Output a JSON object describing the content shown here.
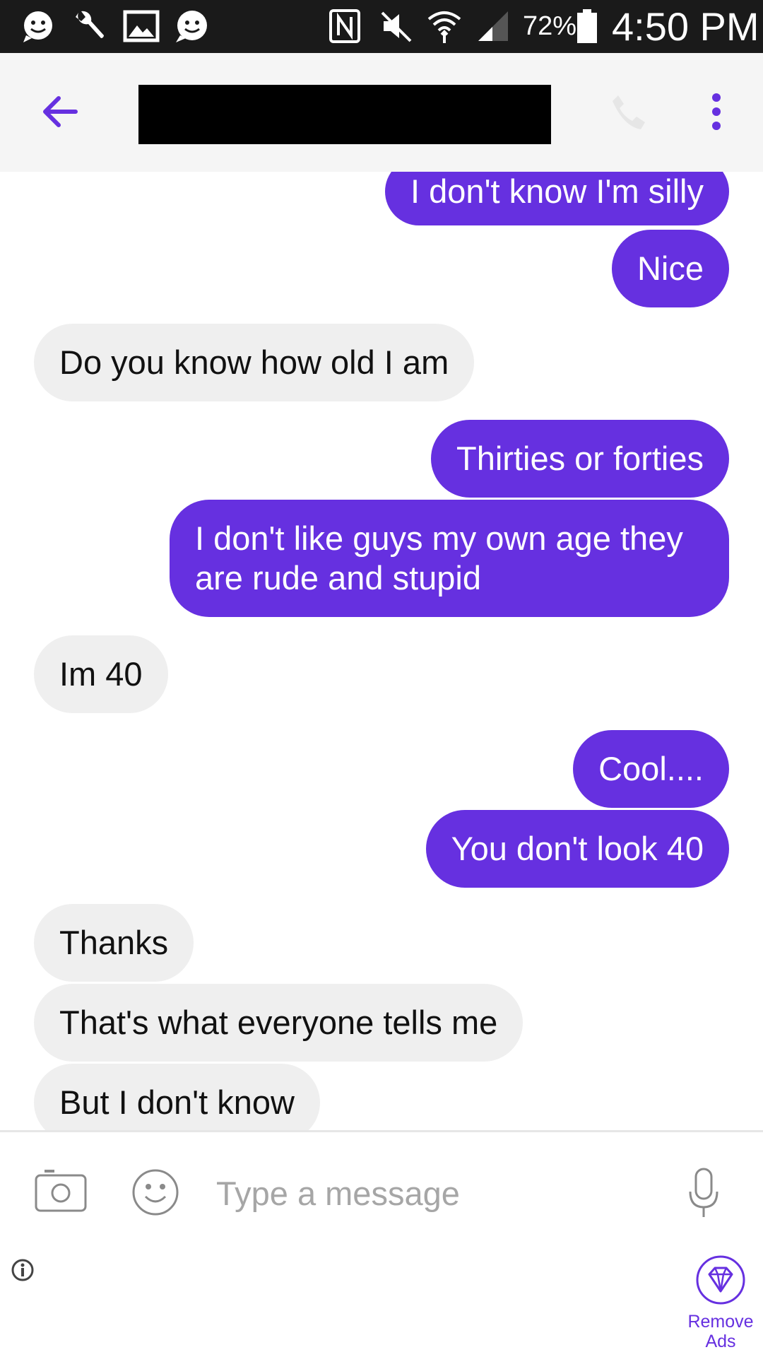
{
  "status_bar": {
    "battery_percent": "72%",
    "time": "4:50 PM",
    "icons": [
      "smiley-chat-icon",
      "wrench-icon",
      "image-icon",
      "chat-bubble-icon",
      "nfc-icon",
      "mute-icon",
      "wifi-icon",
      "signal-icon",
      "battery-icon"
    ]
  },
  "header": {
    "back_icon": "arrow-left-icon",
    "contact_name": "",
    "call_icon": "phone-icon",
    "menu_icon": "more-vertical-icon"
  },
  "messages": [
    {
      "direction": "sent",
      "text": "I don't know I'm silly"
    },
    {
      "direction": "sent",
      "text": "Nice"
    },
    {
      "direction": "received",
      "text": "Do you know how old I am"
    },
    {
      "direction": "sent",
      "text": "Thirties or forties"
    },
    {
      "direction": "sent",
      "text": "I don't like guys my own age they are rude and stupid"
    },
    {
      "direction": "received",
      "text": "Im 40"
    },
    {
      "direction": "sent",
      "text": "Cool...."
    },
    {
      "direction": "sent",
      "text": "You don't look 40"
    },
    {
      "direction": "received",
      "text": "Thanks"
    },
    {
      "direction": "received",
      "text": "That's what everyone tells me"
    },
    {
      "direction": "received",
      "text": "But I don't know"
    }
  ],
  "input_bar": {
    "placeholder": "Type a message",
    "value": ""
  },
  "ads": {
    "remove_ads_label": "Remove Ads"
  },
  "colors": {
    "accent": "#6630e0",
    "received_bubble": "#efefef",
    "status_bar": "#1a1a1a",
    "header_bg": "#f5f5f5"
  }
}
